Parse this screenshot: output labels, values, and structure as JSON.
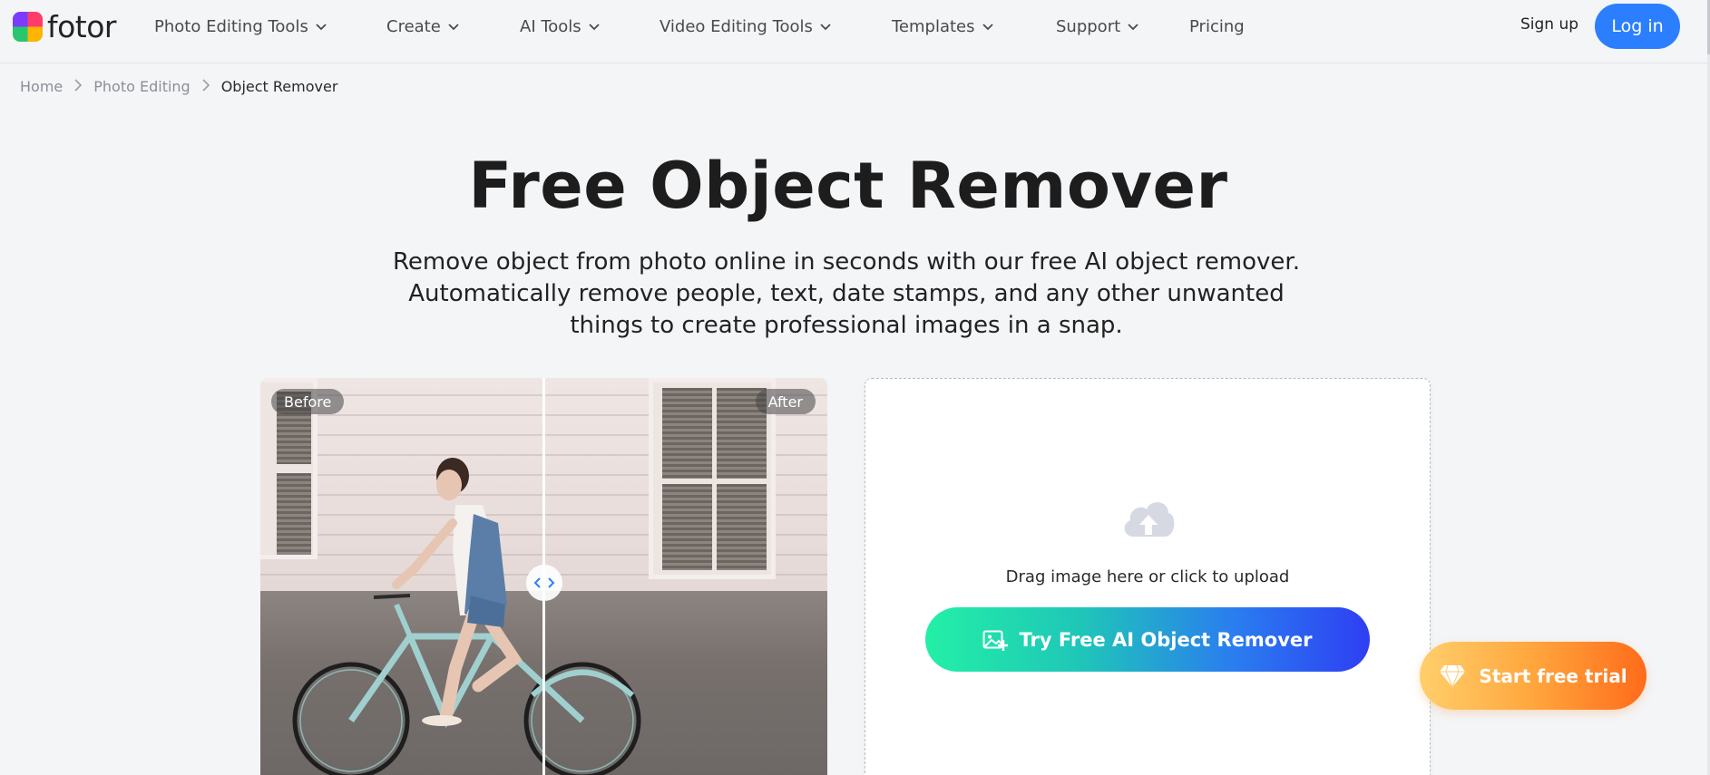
{
  "brand": {
    "name": "fotor"
  },
  "nav": {
    "items": [
      {
        "label": "Photo Editing Tools",
        "has_dropdown": true
      },
      {
        "label": "Create",
        "has_dropdown": true
      },
      {
        "label": "AI Tools",
        "has_dropdown": true
      },
      {
        "label": "Video Editing Tools",
        "has_dropdown": true
      },
      {
        "label": "Templates",
        "has_dropdown": true
      },
      {
        "label": "Support",
        "has_dropdown": true
      },
      {
        "label": "Pricing",
        "has_dropdown": false
      }
    ],
    "signup_label": "Sign up",
    "login_label": "Log in"
  },
  "breadcrumb": {
    "home": "Home",
    "section": "Photo Editing",
    "current": "Object Remover"
  },
  "hero": {
    "title": "Free Object Remover",
    "subtitle_line1": "Remove object from photo online in seconds with our free AI object remover.",
    "subtitle_line2": "Automatically remove people, text, date stamps, and any other unwanted",
    "subtitle_line3": "things to create professional images in a snap."
  },
  "compare": {
    "before_label": "Before",
    "after_label": "After",
    "handle_icon": "chevron-left-right-icon"
  },
  "upload": {
    "icon": "cloud-upload-icon",
    "drag_text": "Drag image here or click to upload",
    "cta_label": "Try Free AI Object Remover",
    "cta_icon": "image-add-icon"
  },
  "trial": {
    "label": "Start free trial",
    "icon": "diamond-icon"
  },
  "colors": {
    "primary": "#2b7fff",
    "page_bg": "#f4f5f7",
    "cta_gradient_start": "#23f0a6",
    "cta_gradient_end": "#2e3ff2",
    "trial_gradient_start": "#ffcf6b",
    "trial_gradient_end": "#ff6b1a"
  }
}
